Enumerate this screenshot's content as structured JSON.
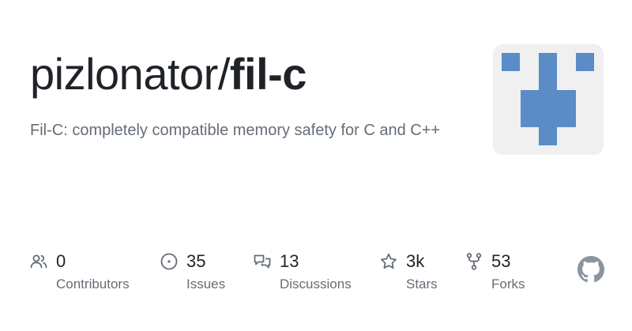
{
  "repo": {
    "owner": "pizlonator/",
    "name": "fil-c",
    "description": "Fil-C: completely compatible memory safety for C and C++"
  },
  "avatar": {
    "background": "#f0f0f0",
    "color": "#5b8cc8"
  },
  "stats": {
    "contributors": {
      "value": "0",
      "label": "Contributors",
      "icon": "people-icon"
    },
    "issues": {
      "value": "35",
      "label": "Issues",
      "icon": "issue-opened-icon"
    },
    "discussions": {
      "value": "13",
      "label": "Discussions",
      "icon": "comment-discussion-icon"
    },
    "stars": {
      "value": "3k",
      "label": "Stars",
      "icon": "star-icon"
    },
    "forks": {
      "value": "53",
      "label": "Forks",
      "icon": "repo-forked-icon"
    }
  },
  "colors": {
    "text_primary": "#1f2328",
    "text_secondary": "#656d76",
    "icon": "#656d76"
  }
}
